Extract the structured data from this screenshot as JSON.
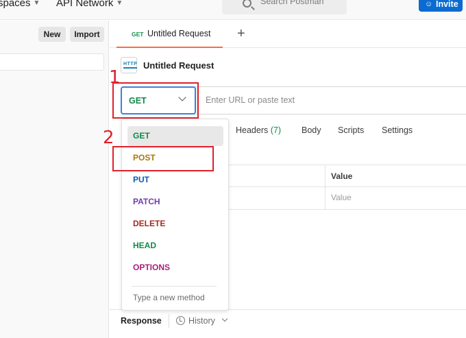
{
  "topbar": {
    "nav": [
      {
        "label": "spaces"
      },
      {
        "label": "API Network"
      }
    ],
    "search_placeholder": "Search Postman",
    "invite_label": "Invite"
  },
  "sidebar": {
    "new_label": "New",
    "import_label": "Import"
  },
  "tabs": [
    {
      "method": "GET",
      "title": "Untitled Request"
    }
  ],
  "request": {
    "title": "Untitled Request",
    "icon_text": "HTTP",
    "method": "GET",
    "url_placeholder": "Enter URL or paste text",
    "option_tabs": [
      {
        "label": "Headers",
        "count": "(7)"
      },
      {
        "label": "Body"
      },
      {
        "label": "Scripts"
      },
      {
        "label": "Settings"
      }
    ]
  },
  "params_table": {
    "column_value": "Value",
    "value_placeholder": "Value"
  },
  "method_dropdown": {
    "items": [
      {
        "label": "GET",
        "color": "#0f8a4a",
        "highlighted": true
      },
      {
        "label": "POST",
        "color": "#ad7a03"
      },
      {
        "label": "PUT",
        "color": "#0b5fb3"
      },
      {
        "label": "PATCH",
        "color": "#6f3ea8"
      },
      {
        "label": "DELETE",
        "color": "#a8281f"
      },
      {
        "label": "HEAD",
        "color": "#0f8a4a"
      },
      {
        "label": "OPTIONS",
        "color": "#a8207a"
      }
    ],
    "new_method_label": "Type a new method"
  },
  "response": {
    "label": "Response",
    "history_label": "History"
  },
  "annotations": [
    {
      "number": "1"
    },
    {
      "number": "2"
    }
  ],
  "colors": {
    "accent": "#ff6c37",
    "primary": "#0b6bd0",
    "annotation": "#e0202a"
  }
}
